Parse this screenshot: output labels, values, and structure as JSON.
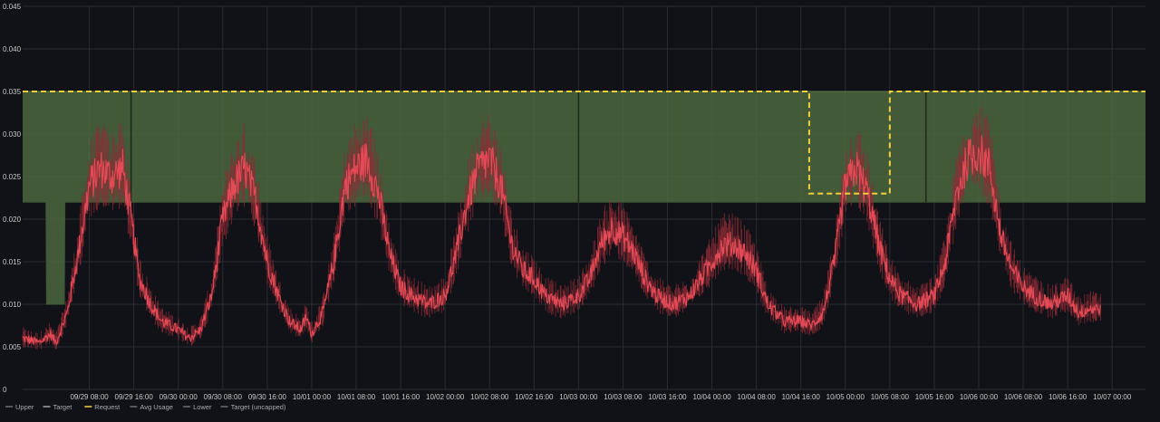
{
  "colors": {
    "background": "#111217",
    "grid": "#2a2c33",
    "tick_text": "#c7c8cc",
    "band_fill": "#4d6a3f",
    "band_fill_opacity": 0.82,
    "request": "#f2d03b",
    "avg_usage": "#e34a56",
    "avg_usage_spikes": "#8f2a34",
    "target_line": "#1c2a1c",
    "legend_text": "#a8aab0"
  },
  "chart_data": {
    "type": "line",
    "title": "",
    "xlabel": "",
    "ylabel": "",
    "ylim": [
      0,
      0.045
    ],
    "yticks": [
      "0",
      "0.005",
      "0.010",
      "0.015",
      "0.020",
      "0.025",
      "0.030",
      "0.035",
      "0.040",
      "0.045"
    ],
    "time_range_hours": [
      0,
      202
    ],
    "xticks": [
      {
        "h": 12,
        "label": "09/29 08:00"
      },
      {
        "h": 20,
        "label": "09/29 16:00"
      },
      {
        "h": 28,
        "label": "09/30 00:00"
      },
      {
        "h": 36,
        "label": "09/30 08:00"
      },
      {
        "h": 44,
        "label": "09/30 16:00"
      },
      {
        "h": 52,
        "label": "10/01 00:00"
      },
      {
        "h": 60,
        "label": "10/01 08:00"
      },
      {
        "h": 68,
        "label": "10/01 16:00"
      },
      {
        "h": 76,
        "label": "10/02 00:00"
      },
      {
        "h": 84,
        "label": "10/02 08:00"
      },
      {
        "h": 92,
        "label": "10/02 16:00"
      },
      {
        "h": 100,
        "label": "10/03 00:00"
      },
      {
        "h": 108,
        "label": "10/03 08:00"
      },
      {
        "h": 116,
        "label": "10/03 16:00"
      },
      {
        "h": 124,
        "label": "10/04 00:00"
      },
      {
        "h": 132,
        "label": "10/04 08:00"
      },
      {
        "h": 140,
        "label": "10/04 16:00"
      },
      {
        "h": 148,
        "label": "10/05 00:00"
      },
      {
        "h": 156,
        "label": "10/05 08:00"
      },
      {
        "h": 164,
        "label": "10/05 16:00"
      },
      {
        "h": 172,
        "label": "10/06 00:00"
      },
      {
        "h": 180,
        "label": "10/06 08:00"
      },
      {
        "h": 188,
        "label": "10/06 16:00"
      },
      {
        "h": 196,
        "label": "10/07 00:00"
      }
    ],
    "legend": [
      "Upper",
      "Target",
      "Request",
      "Avg Usage",
      "Lower",
      "Target (uncapped)"
    ],
    "legend_placement": "bottom-left",
    "grid": true,
    "series": [
      {
        "name": "Upper",
        "kind": "band-top",
        "points": [
          [
            0,
            0.035
          ],
          [
            202,
            0.035
          ]
        ]
      },
      {
        "name": "Lower",
        "kind": "band-bottom",
        "points": [
          [
            0,
            0.022
          ],
          [
            4.2,
            0.022
          ],
          [
            4.3,
            0.01
          ],
          [
            7.5,
            0.01
          ],
          [
            7.6,
            0.022
          ],
          [
            202,
            0.022
          ]
        ]
      },
      {
        "name": "Request",
        "kind": "step-dashed",
        "points": [
          [
            0,
            0.035
          ],
          [
            141.5,
            0.035
          ],
          [
            141.5,
            0.023
          ],
          [
            156,
            0.023
          ],
          [
            156,
            0.035
          ],
          [
            202,
            0.035
          ]
        ]
      },
      {
        "name": "Target",
        "kind": "vertical-markers",
        "x_hours": [
          19.5,
          100,
          162.5
        ],
        "range": [
          0.022,
          0.035
        ]
      },
      {
        "name": "Avg Usage",
        "kind": "line",
        "points": [
          [
            0,
            0.006
          ],
          [
            3,
            0.0055
          ],
          [
            5,
            0.0065
          ],
          [
            6,
            0.0055
          ],
          [
            8,
            0.009
          ],
          [
            10,
            0.016
          ],
          [
            12,
            0.024
          ],
          [
            14,
            0.026
          ],
          [
            16,
            0.025
          ],
          [
            18,
            0.026
          ],
          [
            19.5,
            0.02
          ],
          [
            21,
            0.013
          ],
          [
            23,
            0.01
          ],
          [
            25,
            0.008
          ],
          [
            28,
            0.007
          ],
          [
            30,
            0.006
          ],
          [
            32,
            0.007
          ],
          [
            34,
            0.011
          ],
          [
            36,
            0.02
          ],
          [
            38,
            0.024
          ],
          [
            40,
            0.026
          ],
          [
            42,
            0.022
          ],
          [
            44,
            0.015
          ],
          [
            46,
            0.011
          ],
          [
            48,
            0.008
          ],
          [
            50,
            0.007
          ],
          [
            51,
            0.0085
          ],
          [
            52,
            0.0065
          ],
          [
            54,
            0.009
          ],
          [
            56,
            0.015
          ],
          [
            58,
            0.024
          ],
          [
            60,
            0.026
          ],
          [
            62,
            0.027
          ],
          [
            64,
            0.023
          ],
          [
            66,
            0.016
          ],
          [
            68,
            0.012
          ],
          [
            70,
            0.011
          ],
          [
            73,
            0.01
          ],
          [
            76,
            0.011
          ],
          [
            78,
            0.016
          ],
          [
            80,
            0.022
          ],
          [
            82,
            0.026
          ],
          [
            84,
            0.027
          ],
          [
            86,
            0.024
          ],
          [
            88,
            0.017
          ],
          [
            90,
            0.014
          ],
          [
            92,
            0.013
          ],
          [
            94,
            0.011
          ],
          [
            97,
            0.01
          ],
          [
            100,
            0.011
          ],
          [
            102,
            0.013
          ],
          [
            104,
            0.017
          ],
          [
            106,
            0.019
          ],
          [
            108,
            0.018
          ],
          [
            110,
            0.016
          ],
          [
            112,
            0.013
          ],
          [
            114,
            0.011
          ],
          [
            117,
            0.01
          ],
          [
            120,
            0.011
          ],
          [
            122,
            0.013
          ],
          [
            124,
            0.015
          ],
          [
            126,
            0.017
          ],
          [
            128,
            0.017
          ],
          [
            130,
            0.016
          ],
          [
            132,
            0.014
          ],
          [
            134,
            0.01
          ],
          [
            137,
            0.008
          ],
          [
            140,
            0.008
          ],
          [
            142,
            0.0075
          ],
          [
            144,
            0.009
          ],
          [
            146,
            0.015
          ],
          [
            148,
            0.024
          ],
          [
            150,
            0.026
          ],
          [
            152,
            0.023
          ],
          [
            154,
            0.017
          ],
          [
            156,
            0.013
          ],
          [
            158,
            0.011
          ],
          [
            161,
            0.01
          ],
          [
            164,
            0.011
          ],
          [
            166,
            0.015
          ],
          [
            168,
            0.023
          ],
          [
            170,
            0.027
          ],
          [
            172,
            0.028
          ],
          [
            174,
            0.026
          ],
          [
            176,
            0.018
          ],
          [
            178,
            0.014
          ],
          [
            180,
            0.012
          ],
          [
            182,
            0.011
          ],
          [
            185,
            0.01
          ],
          [
            188,
            0.011
          ],
          [
            190,
            0.009
          ],
          [
            192,
            0.0095
          ],
          [
            194,
            0.0095
          ]
        ]
      }
    ]
  }
}
